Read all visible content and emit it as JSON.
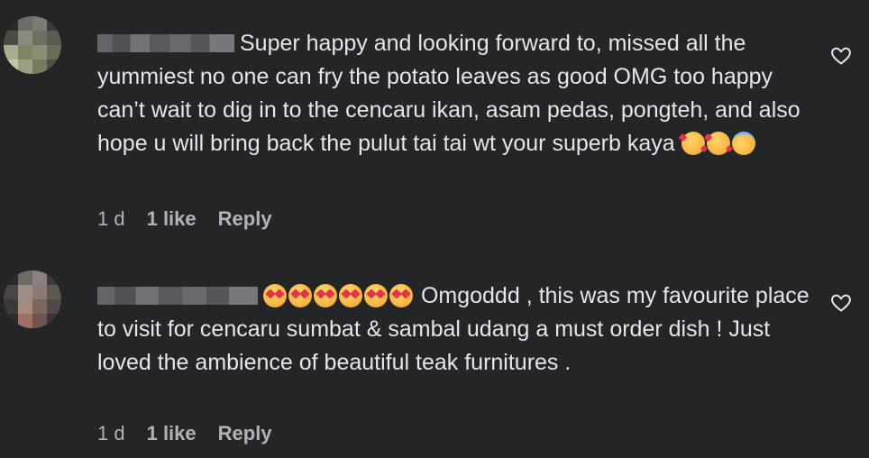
{
  "comments": [
    {
      "text": "Super happy and looking forward to, missed all the yummiest no one can fry the potato leaves as good OMG too happy can’t wait to dig in to the cencaru ikan, asam pedas, pongteh, and also hope u will bring back the pulut tai tai wt your superb kaya",
      "trailing_emojis": [
        "smiling-face-with-hearts-emoji",
        "smiling-face-with-hearts-emoji",
        "smiling-face-with-halo-emoji"
      ],
      "time": "1 d",
      "likes": "1 like",
      "reply": "Reply",
      "like_icon": "heart-outline-icon"
    },
    {
      "leading_emojis": [
        "heart-eyes-emoji",
        "heart-eyes-emoji",
        "heart-eyes-emoji",
        "heart-eyes-emoji",
        "heart-eyes-emoji",
        "heart-eyes-emoji"
      ],
      "text": "Omgoddd , this was my favourite place to visit for cencaru sumbat & sambal udang a must order dish ! Just loved the ambience of beautiful teak furnitures .",
      "time": "1 d",
      "likes": "1 like",
      "reply": "Reply",
      "like_icon": "heart-outline-icon"
    }
  ],
  "colors": {
    "background": "#242526",
    "primary_text": "#e4e6eb",
    "secondary_text": "#b0b3b8"
  }
}
